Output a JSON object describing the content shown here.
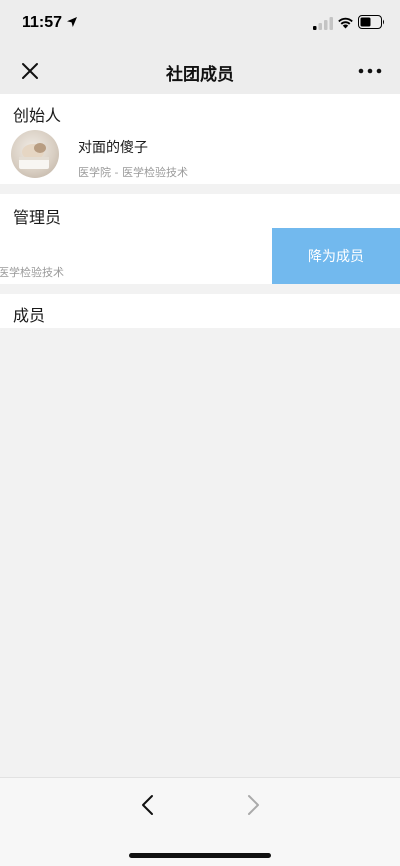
{
  "status_bar": {
    "time": "11:57",
    "icons": [
      "location-arrow-icon",
      "signal-icon",
      "wifi-icon",
      "battery-icon"
    ]
  },
  "nav": {
    "title": "社团成员",
    "close_icon": "close-icon",
    "more_icon": "more-icon"
  },
  "sections": {
    "founder": {
      "title": "创始人",
      "member": {
        "name": "对面的傻子",
        "meta": "医学院 - 医学检验技术"
      }
    },
    "admins": {
      "title": "管理员",
      "member": {
        "meta": "医学检验技术"
      },
      "action_label": "降为成员"
    },
    "members": {
      "title": "成员"
    }
  },
  "bottom_bar": {
    "icons": [
      "back-icon",
      "forward-icon"
    ]
  },
  "colors": {
    "nav_bg": "#ededed",
    "page_bg": "#f2f2f2",
    "action_button": "#72b9ee",
    "meta_text": "#9a9a9a"
  }
}
